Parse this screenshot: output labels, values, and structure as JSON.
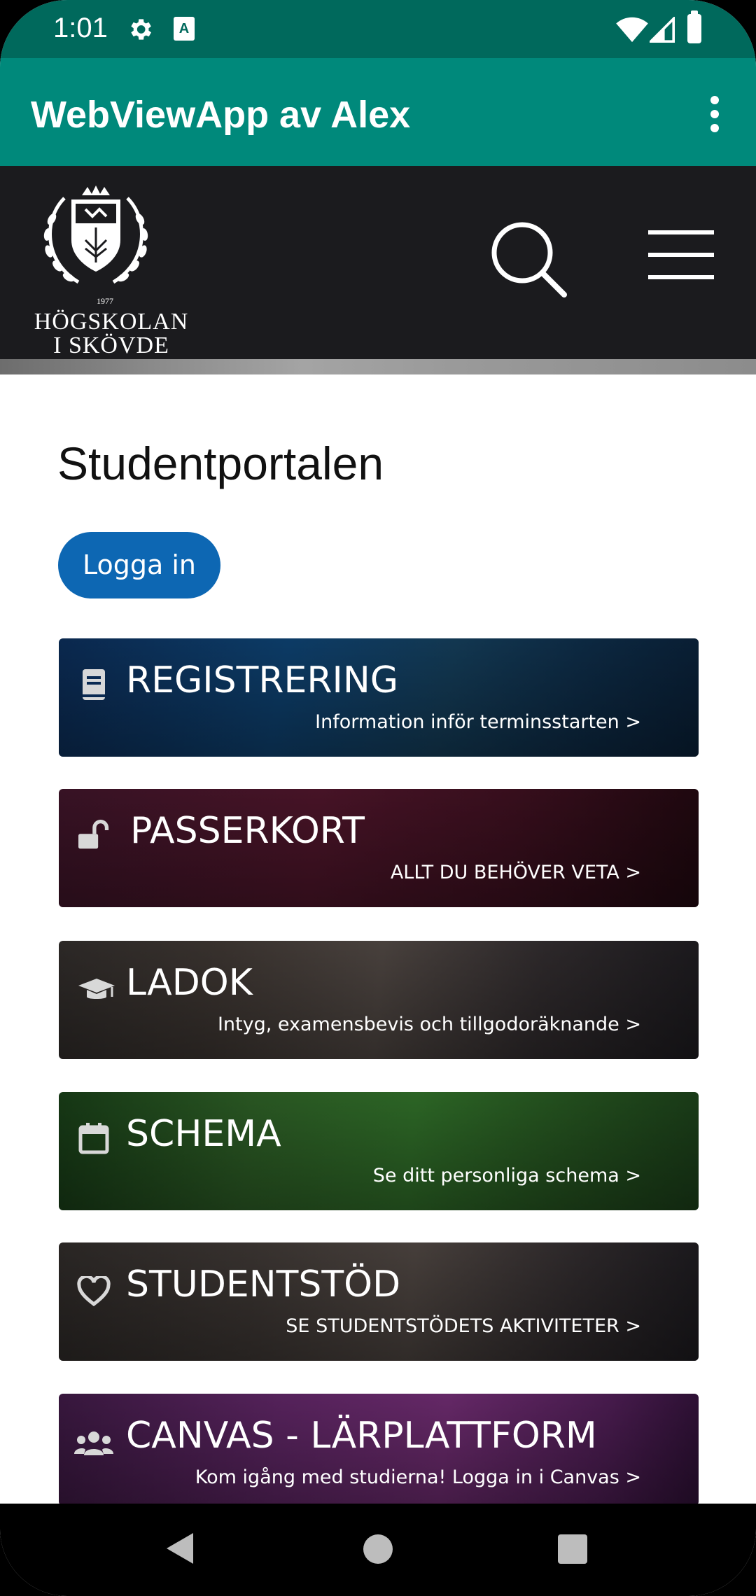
{
  "status": {
    "time": "1:01"
  },
  "appbar": {
    "title": "WebViewApp av Alex"
  },
  "site": {
    "logo_name_line1": "HÖGSKOLAN",
    "logo_name_line2": "I SKÖVDE",
    "logo_year": "1977"
  },
  "page": {
    "title": "Studentportalen",
    "login_label": "Logga in"
  },
  "cards": [
    {
      "title": "REGISTRERING",
      "subtitle": "Information inför terminsstarten >",
      "icon": "book-icon"
    },
    {
      "title": "PASSERKORT",
      "subtitle": "ALLT DU BEHÖVER VETA >",
      "icon": "unlock-icon"
    },
    {
      "title": "LADOK",
      "subtitle": "Intyg, examensbevis och tillgodoräknande >",
      "icon": "graduation-cap-icon"
    },
    {
      "title": "SCHEMA",
      "subtitle": "Se ditt personliga schema >",
      "icon": "calendar-icon"
    },
    {
      "title": "STUDENTSTÖD",
      "subtitle": "SE STUDENTSTÖDETS AKTIVITETER >",
      "icon": "heart-icon"
    },
    {
      "title": "CANVAS - LÄRPLATTFORM",
      "subtitle": "Kom igång med studierna! Logga in i Canvas >",
      "icon": "users-icon"
    }
  ],
  "colors": {
    "status_bar": "#00695c",
    "app_bar": "#00897b",
    "header": "#1b1b1e",
    "button": "#0d67b3"
  }
}
